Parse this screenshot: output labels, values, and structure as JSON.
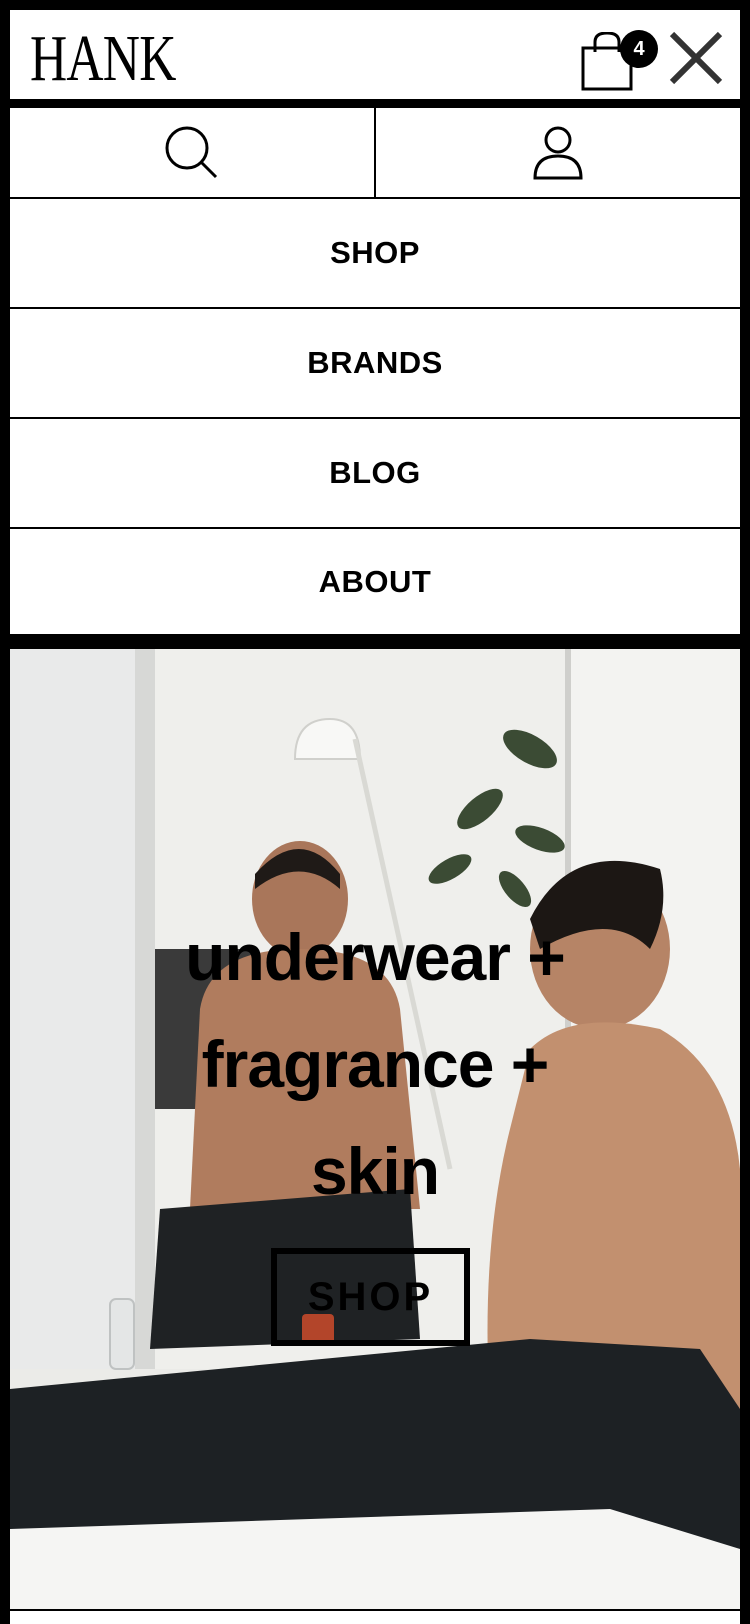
{
  "header": {
    "logo": "HANK",
    "cart_count": "4"
  },
  "icons": {
    "cart": "shopping-bag-icon",
    "close": "close-icon",
    "search": "search-icon",
    "account": "user-icon"
  },
  "menu": {
    "items": [
      {
        "label": "SHOP"
      },
      {
        "label": "BRANDS"
      },
      {
        "label": "BLOG"
      },
      {
        "label": "ABOUT"
      }
    ]
  },
  "hero": {
    "lines": [
      "underwear +",
      "fragrance +",
      "skin"
    ],
    "cta": "SHOP"
  },
  "colors": {
    "frame": "#000000",
    "background": "#ffffff",
    "text": "#000000"
  }
}
